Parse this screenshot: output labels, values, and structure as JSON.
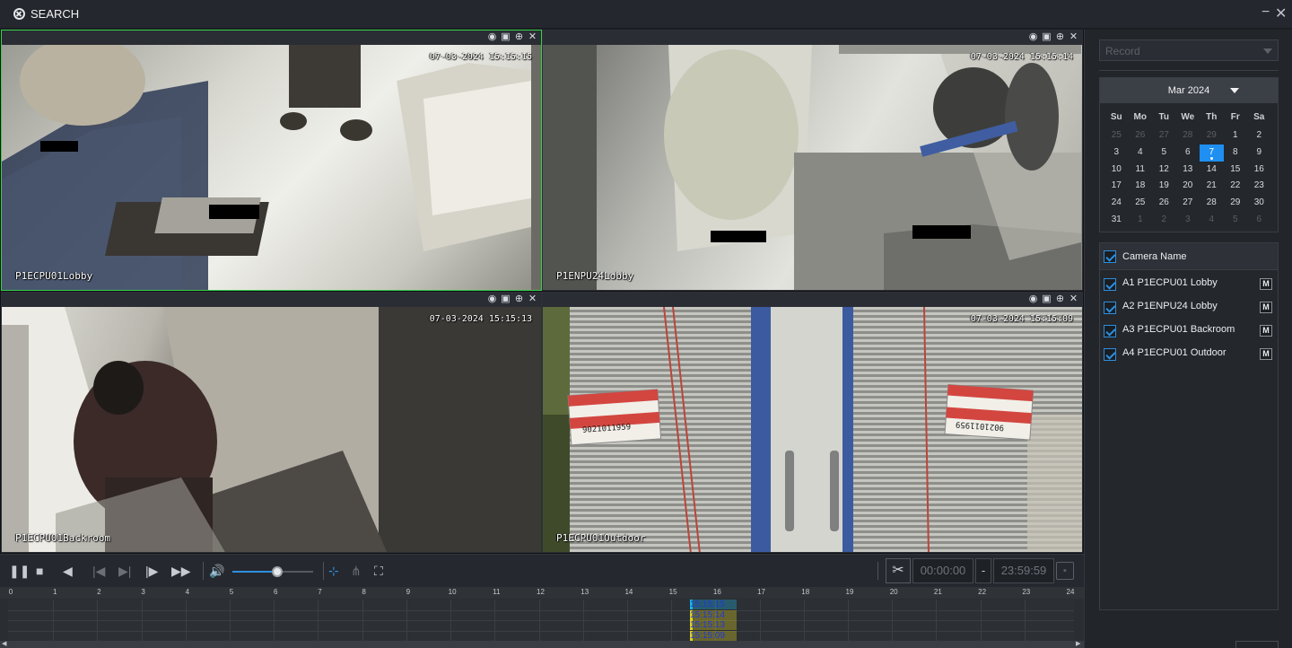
{
  "window": {
    "title": "SEARCH",
    "minimize_icon": "minus-icon",
    "close_icon": "close-icon"
  },
  "tiles": [
    {
      "timestamp": "07-03-2024 15:15:15",
      "camera_label": "P1ECPU01Lobby",
      "selected": true
    },
    {
      "timestamp": "07-03-2024 15:15:14",
      "camera_label": "P1ENPU24Lobby",
      "selected": false
    },
    {
      "timestamp": "07-03-2024 15:15:13",
      "camera_label": "P1ECPU01Backroom",
      "selected": false
    },
    {
      "timestamp": "07-03-2024 15:15:09",
      "camera_label": "P1ECPU01Outdoor",
      "selected": false
    }
  ],
  "tile_tools": [
    "eye-icon",
    "snapshot-icon",
    "zoom-icon",
    "close-icon"
  ],
  "scene4_signs": {
    "left_number": "9021011959",
    "right_number": "9021011959"
  },
  "player": {
    "volume_level": 0.55,
    "start_time": "00:00:00",
    "range_separator": "-",
    "end_time": "23:59:59"
  },
  "timeline": {
    "hours": [
      "0",
      "1",
      "2",
      "3",
      "4",
      "5",
      "6",
      "7",
      "8",
      "9",
      "10",
      "11",
      "12",
      "13",
      "14",
      "15",
      "16",
      "17",
      "18",
      "19",
      "20",
      "21",
      "22",
      "23",
      "24"
    ],
    "track_labels": [
      {
        "text": "15:15:15",
        "color": "#1fb7e0",
        "text_color": "#2038d6"
      },
      {
        "text": "15:15:14",
        "color": "#e0d21f",
        "text_color": "#2038d6"
      },
      {
        "text": "15:15:13",
        "color": "#e0d21f",
        "text_color": "#2038d6"
      },
      {
        "text": "15:15:09",
        "color": "#e0d21f",
        "text_color": "#2038d6"
      }
    ]
  },
  "record_select": {
    "placeholder": "Record"
  },
  "calendar": {
    "month_label": "Mar 2024",
    "weekdays": [
      "Su",
      "Mo",
      "Tu",
      "We",
      "Th",
      "Fr",
      "Sa"
    ],
    "days": [
      {
        "d": "25",
        "out": true
      },
      {
        "d": "26",
        "out": true
      },
      {
        "d": "27",
        "out": true
      },
      {
        "d": "28",
        "out": true
      },
      {
        "d": "29",
        "out": true
      },
      {
        "d": "1",
        "out": false
      },
      {
        "d": "2",
        "out": false
      },
      {
        "d": "3",
        "out": false
      },
      {
        "d": "4",
        "out": false
      },
      {
        "d": "5",
        "out": false
      },
      {
        "d": "6",
        "out": false
      },
      {
        "d": "7",
        "out": false,
        "sel": true
      },
      {
        "d": "8",
        "out": false
      },
      {
        "d": "9",
        "out": false
      },
      {
        "d": "10",
        "out": false
      },
      {
        "d": "11",
        "out": false
      },
      {
        "d": "12",
        "out": false
      },
      {
        "d": "13",
        "out": false
      },
      {
        "d": "14",
        "out": false
      },
      {
        "d": "15",
        "out": false
      },
      {
        "d": "16",
        "out": false
      },
      {
        "d": "17",
        "out": false
      },
      {
        "d": "18",
        "out": false
      },
      {
        "d": "19",
        "out": false
      },
      {
        "d": "20",
        "out": false
      },
      {
        "d": "21",
        "out": false
      },
      {
        "d": "22",
        "out": false
      },
      {
        "d": "23",
        "out": false
      },
      {
        "d": "24",
        "out": false
      },
      {
        "d": "25",
        "out": false
      },
      {
        "d": "26",
        "out": false
      },
      {
        "d": "27",
        "out": false
      },
      {
        "d": "28",
        "out": false
      },
      {
        "d": "29",
        "out": false
      },
      {
        "d": "30",
        "out": false
      },
      {
        "d": "31",
        "out": false
      },
      {
        "d": "1",
        "out": true
      },
      {
        "d": "2",
        "out": true
      },
      {
        "d": "3",
        "out": true
      },
      {
        "d": "4",
        "out": true
      },
      {
        "d": "5",
        "out": true
      },
      {
        "d": "6",
        "out": true
      }
    ],
    "selected_color": "#1f8ff2"
  },
  "camera_list": {
    "header": "Camera Name",
    "items": [
      {
        "label": "A1 P1ECPU01 Lobby",
        "checked": true,
        "m_label": "M"
      },
      {
        "label": "A2 P1ENPU24 Lobby",
        "checked": true,
        "m_label": "M"
      },
      {
        "label": "A3 P1ECPU01 Backroom",
        "checked": true,
        "m_label": "M"
      },
      {
        "label": "A4 P1ECPU01 Outdoor",
        "checked": true,
        "m_label": "M"
      }
    ]
  }
}
